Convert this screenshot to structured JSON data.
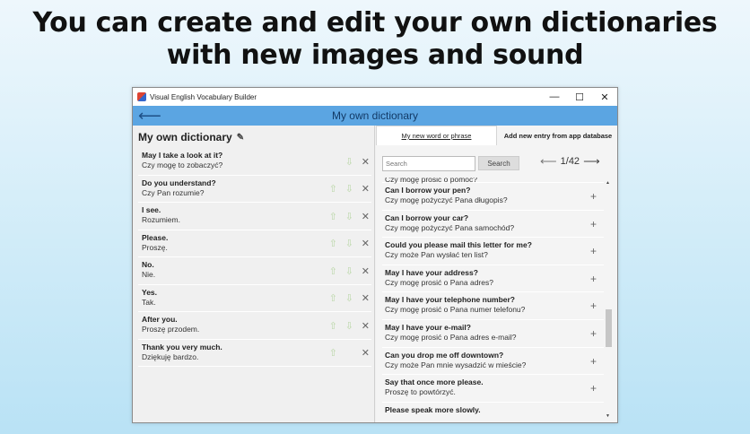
{
  "headline": {
    "line1": "You can create and edit your own dictionaries",
    "line2": "with new images and sound"
  },
  "window": {
    "title": "Visual English Vocabulary Builder",
    "controls": {
      "minimize": "—",
      "maximize": "☐",
      "close": "✕"
    }
  },
  "header": {
    "back": "⟵",
    "title": "My own dictionary"
  },
  "left": {
    "title": "My own dictionary",
    "entries": [
      {
        "en": "May I take a look at it?",
        "pl": "Czy mogę to zobaczyć?"
      },
      {
        "en": "Do you understand?",
        "pl": "Czy Pan rozumie?"
      },
      {
        "en": "I see.",
        "pl": "Rozumiem."
      },
      {
        "en": "Please.",
        "pl": "Proszę."
      },
      {
        "en": "No.",
        "pl": "Nie."
      },
      {
        "en": "Yes.",
        "pl": "Tak."
      },
      {
        "en": "After you.",
        "pl": "Proszę przodem."
      },
      {
        "en": "Thank you very much.",
        "pl": "Dziękuję bardzo."
      }
    ]
  },
  "right": {
    "tabs": {
      "new_word": "My new word or phrase",
      "from_db": "Add new entry from app database"
    },
    "search": {
      "placeholder": "Search",
      "button": "Search"
    },
    "pager": {
      "prev": "⟵",
      "label": "1/42",
      "next": "⟶"
    },
    "top_partial": "Czy mogę prosić o pomoc?",
    "entries": [
      {
        "en": "Can I borrow your pen?",
        "pl": "Czy mogę pożyczyć Pana długopis?"
      },
      {
        "en": "Can I borrow your car?",
        "pl": "Czy mogę pożyczyć Pana samochód?"
      },
      {
        "en": "Could you please mail this letter for me?",
        "pl": "Czy może Pan wysłać ten list?"
      },
      {
        "en": "May I have your address?",
        "pl": "Czy mogę prosić o Pana adres?"
      },
      {
        "en": "May I have your telephone number?",
        "pl": "Czy mogę prosić o Pana numer telefonu?"
      },
      {
        "en": "May I have your e-mail?",
        "pl": "Czy mogę prosić o Pana adres e-mail?"
      },
      {
        "en": "Can you drop me off downtown?",
        "pl": "Czy może Pan mnie wysadzić w mieście?"
      },
      {
        "en": "Say that once more please.",
        "pl": "Proszę to powtórzyć."
      },
      {
        "en": "Please speak more slowly.",
        "pl": ""
      }
    ]
  },
  "icons": {
    "up": "⇧",
    "down": "⇩",
    "delete": "✕",
    "plus": "+",
    "pencil": "✎"
  }
}
